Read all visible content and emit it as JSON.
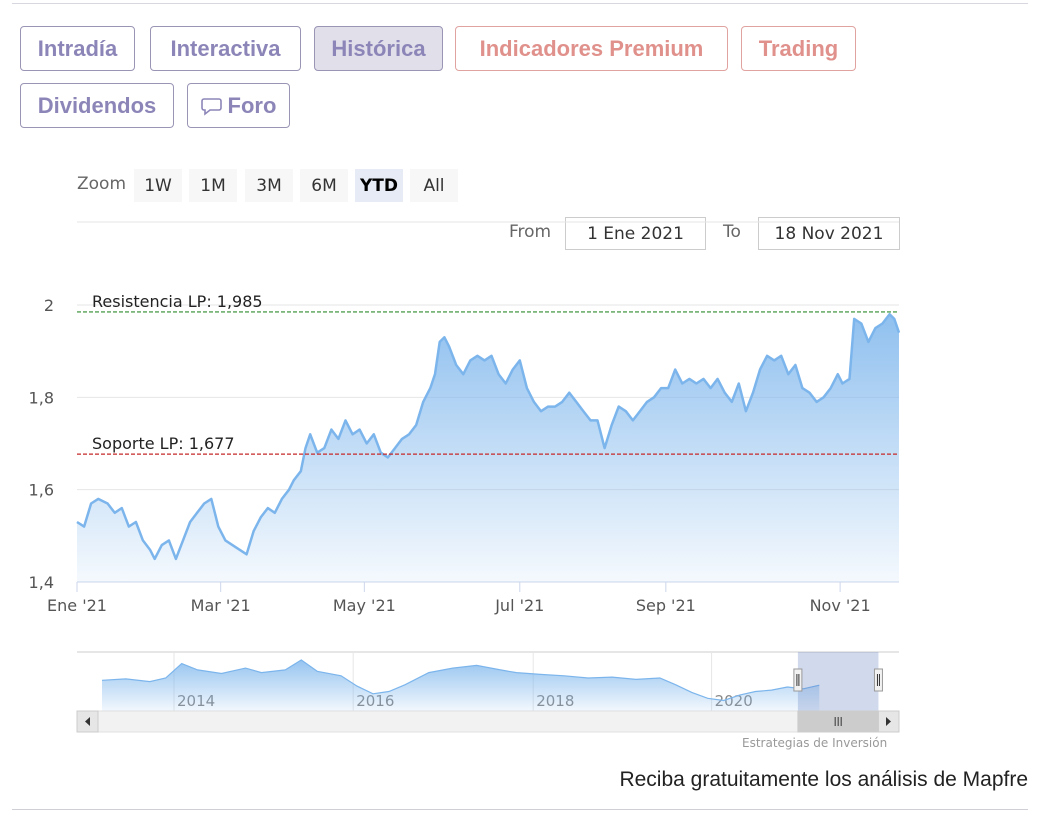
{
  "tabs": [
    {
      "label": "Intradía",
      "style": "normal"
    },
    {
      "label": "Interactiva",
      "style": "normal"
    },
    {
      "label": "Histórica",
      "style": "active"
    },
    {
      "label": "Indicadores Premium",
      "style": "premium"
    },
    {
      "label": "Trading",
      "style": "premium"
    },
    {
      "label": "Dividendos",
      "style": "normal"
    },
    {
      "label": "Foro",
      "style": "normal",
      "icon": "chat-bubble-icon"
    }
  ],
  "zoom": {
    "label": "Zoom",
    "buttons": [
      "1W",
      "1M",
      "3M",
      "6M",
      "YTD",
      "All"
    ],
    "selected": "YTD"
  },
  "range": {
    "from_label": "From",
    "from_value": "1 Ene 2021",
    "to_label": "To",
    "to_value": "18 Nov 2021"
  },
  "chart_data": {
    "type": "area",
    "x_start": "2021-01-01",
    "x_end": "2021-11-18",
    "x_tick_labels": [
      "Ene '21",
      "Mar '21",
      "May '21",
      "Jul '21",
      "Sep '21",
      "Nov '21"
    ],
    "y_tick_labels": [
      "1,4",
      "1,6",
      "1,8",
      "2"
    ],
    "ylim": [
      1.4,
      2.0
    ],
    "grid": true,
    "series": [
      {
        "color": "#7cb5ec",
        "points": [
          [
            "2021-01-01",
            1.53
          ],
          [
            "2021-01-04",
            1.52
          ],
          [
            "2021-01-07",
            1.57
          ],
          [
            "2021-01-10",
            1.58
          ],
          [
            "2021-01-14",
            1.57
          ],
          [
            "2021-01-17",
            1.55
          ],
          [
            "2021-01-20",
            1.56
          ],
          [
            "2021-01-23",
            1.52
          ],
          [
            "2021-01-26",
            1.53
          ],
          [
            "2021-01-29",
            1.49
          ],
          [
            "2021-02-01",
            1.47
          ],
          [
            "2021-02-03",
            1.45
          ],
          [
            "2021-02-06",
            1.48
          ],
          [
            "2021-02-09",
            1.49
          ],
          [
            "2021-02-12",
            1.45
          ],
          [
            "2021-02-15",
            1.49
          ],
          [
            "2021-02-18",
            1.53
          ],
          [
            "2021-02-21",
            1.55
          ],
          [
            "2021-02-24",
            1.57
          ],
          [
            "2021-02-27",
            1.58
          ],
          [
            "2021-03-02",
            1.52
          ],
          [
            "2021-03-05",
            1.49
          ],
          [
            "2021-03-08",
            1.48
          ],
          [
            "2021-03-11",
            1.47
          ],
          [
            "2021-03-14",
            1.46
          ],
          [
            "2021-03-17",
            1.51
          ],
          [
            "2021-03-20",
            1.54
          ],
          [
            "2021-03-23",
            1.56
          ],
          [
            "2021-03-26",
            1.55
          ],
          [
            "2021-03-29",
            1.58
          ],
          [
            "2021-04-01",
            1.6
          ],
          [
            "2021-04-03",
            1.62
          ],
          [
            "2021-04-06",
            1.64
          ],
          [
            "2021-04-08",
            1.69
          ],
          [
            "2021-04-10",
            1.72
          ],
          [
            "2021-04-13",
            1.68
          ],
          [
            "2021-04-16",
            1.69
          ],
          [
            "2021-04-19",
            1.73
          ],
          [
            "2021-04-22",
            1.71
          ],
          [
            "2021-04-25",
            1.75
          ],
          [
            "2021-04-28",
            1.72
          ],
          [
            "2021-05-01",
            1.73
          ],
          [
            "2021-05-04",
            1.7
          ],
          [
            "2021-05-07",
            1.72
          ],
          [
            "2021-05-10",
            1.68
          ],
          [
            "2021-05-13",
            1.67
          ],
          [
            "2021-05-16",
            1.69
          ],
          [
            "2021-05-19",
            1.71
          ],
          [
            "2021-05-22",
            1.72
          ],
          [
            "2021-05-25",
            1.74
          ],
          [
            "2021-05-28",
            1.79
          ],
          [
            "2021-05-31",
            1.82
          ],
          [
            "2021-06-02",
            1.85
          ],
          [
            "2021-06-04",
            1.92
          ],
          [
            "2021-06-06",
            1.93
          ],
          [
            "2021-06-08",
            1.91
          ],
          [
            "2021-06-11",
            1.87
          ],
          [
            "2021-06-14",
            1.85
          ],
          [
            "2021-06-17",
            1.88
          ],
          [
            "2021-06-20",
            1.89
          ],
          [
            "2021-06-23",
            1.88
          ],
          [
            "2021-06-26",
            1.89
          ],
          [
            "2021-06-29",
            1.85
          ],
          [
            "2021-07-02",
            1.83
          ],
          [
            "2021-07-05",
            1.86
          ],
          [
            "2021-07-08",
            1.88
          ],
          [
            "2021-07-11",
            1.82
          ],
          [
            "2021-07-14",
            1.79
          ],
          [
            "2021-07-17",
            1.77
          ],
          [
            "2021-07-20",
            1.78
          ],
          [
            "2021-07-23",
            1.78
          ],
          [
            "2021-07-26",
            1.79
          ],
          [
            "2021-07-29",
            1.81
          ],
          [
            "2021-08-01",
            1.79
          ],
          [
            "2021-08-04",
            1.77
          ],
          [
            "2021-08-07",
            1.75
          ],
          [
            "2021-08-10",
            1.75
          ],
          [
            "2021-08-13",
            1.69
          ],
          [
            "2021-08-16",
            1.74
          ],
          [
            "2021-08-19",
            1.78
          ],
          [
            "2021-08-22",
            1.77
          ],
          [
            "2021-08-25",
            1.75
          ],
          [
            "2021-08-28",
            1.77
          ],
          [
            "2021-08-31",
            1.79
          ],
          [
            "2021-09-03",
            1.8
          ],
          [
            "2021-09-06",
            1.82
          ],
          [
            "2021-09-09",
            1.82
          ],
          [
            "2021-09-12",
            1.86
          ],
          [
            "2021-09-15",
            1.83
          ],
          [
            "2021-09-18",
            1.84
          ],
          [
            "2021-09-21",
            1.83
          ],
          [
            "2021-09-24",
            1.84
          ],
          [
            "2021-09-27",
            1.82
          ],
          [
            "2021-09-30",
            1.84
          ],
          [
            "2021-10-03",
            1.81
          ],
          [
            "2021-10-06",
            1.79
          ],
          [
            "2021-10-09",
            1.83
          ],
          [
            "2021-10-12",
            1.77
          ],
          [
            "2021-10-15",
            1.81
          ],
          [
            "2021-10-18",
            1.86
          ],
          [
            "2021-10-21",
            1.89
          ],
          [
            "2021-10-24",
            1.88
          ],
          [
            "2021-10-27",
            1.89
          ],
          [
            "2021-10-30",
            1.85
          ],
          [
            "2021-11-02",
            1.87
          ],
          [
            "2021-11-05",
            1.82
          ],
          [
            "2021-11-08",
            1.81
          ],
          [
            "2021-11-11",
            1.79
          ],
          [
            "2021-11-14",
            1.8
          ],
          [
            "2021-11-17",
            1.82
          ],
          [
            "2021-11-20",
            1.85
          ],
          [
            "2021-11-22",
            1.83
          ],
          [
            "2021-11-25",
            1.84
          ],
          [
            "2021-11-27",
            1.97
          ],
          [
            "2021-11-30",
            1.96
          ],
          [
            "2021-12-03",
            1.92
          ],
          [
            "2021-12-06",
            1.95
          ],
          [
            "2021-12-09",
            1.96
          ],
          [
            "2021-12-12",
            1.98
          ],
          [
            "2021-12-14",
            1.97
          ],
          [
            "2021-12-16",
            1.94
          ]
        ]
      }
    ],
    "plot_lines": [
      {
        "label": "Resistencia LP: 1,985",
        "value": 1.985,
        "color": "#2e8b2e"
      },
      {
        "label": "Soporte LP: 1,677",
        "value": 1.677,
        "color": "#c62828"
      }
    ],
    "navigator": {
      "x_tick_labels": [
        "2014",
        "2016",
        "2018",
        "2020"
      ],
      "points": [
        [
          0.0,
          0.55
        ],
        [
          0.03,
          0.58
        ],
        [
          0.06,
          0.52
        ],
        [
          0.08,
          0.6
        ],
        [
          0.1,
          0.92
        ],
        [
          0.12,
          0.78
        ],
        [
          0.15,
          0.7
        ],
        [
          0.18,
          0.82
        ],
        [
          0.2,
          0.72
        ],
        [
          0.23,
          0.78
        ],
        [
          0.25,
          1.0
        ],
        [
          0.27,
          0.75
        ],
        [
          0.3,
          0.65
        ],
        [
          0.32,
          0.42
        ],
        [
          0.34,
          0.25
        ],
        [
          0.36,
          0.3
        ],
        [
          0.38,
          0.45
        ],
        [
          0.41,
          0.72
        ],
        [
          0.44,
          0.82
        ],
        [
          0.47,
          0.88
        ],
        [
          0.5,
          0.78
        ],
        [
          0.52,
          0.72
        ],
        [
          0.55,
          0.68
        ],
        [
          0.58,
          0.65
        ],
        [
          0.61,
          0.6
        ],
        [
          0.64,
          0.62
        ],
        [
          0.67,
          0.57
        ],
        [
          0.7,
          0.6
        ],
        [
          0.72,
          0.45
        ],
        [
          0.74,
          0.28
        ],
        [
          0.76,
          0.15
        ],
        [
          0.78,
          0.1
        ],
        [
          0.8,
          0.22
        ],
        [
          0.82,
          0.3
        ],
        [
          0.84,
          0.33
        ],
        [
          0.86,
          0.4
        ],
        [
          0.88,
          0.36
        ],
        [
          0.9,
          0.44
        ]
      ],
      "selected_from": 0.877,
      "selected_to": 0.975
    }
  },
  "credits": "Estrategias de Inversión",
  "cta": "Reciba gratuitamente los análisis de Mapfre"
}
